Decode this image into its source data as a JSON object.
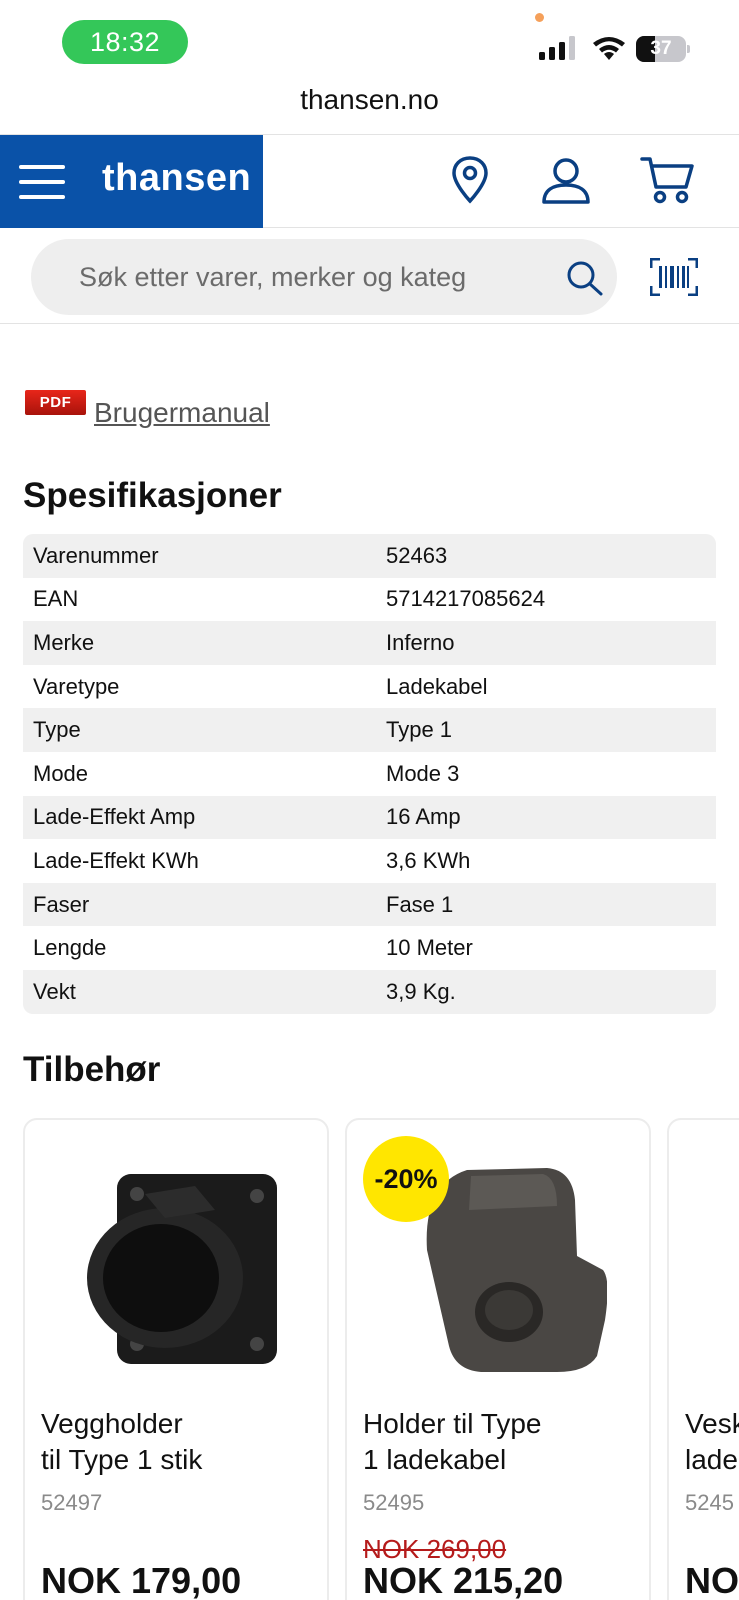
{
  "status_bar": {
    "time": "18:32",
    "battery": "37",
    "battery_level": 0.37
  },
  "browser": {
    "url": "thansen.no"
  },
  "header": {
    "brand": "thansen"
  },
  "search": {
    "placeholder": "Søk etter varer, merker og kateg"
  },
  "manual": {
    "badge": "PDF",
    "label": "Brugermanual"
  },
  "specs": {
    "title": "Spesifikasjoner",
    "rows": [
      {
        "key": "Varenummer",
        "value": "52463"
      },
      {
        "key": "EAN",
        "value": "5714217085624"
      },
      {
        "key": "Merke",
        "value": "Inferno"
      },
      {
        "key": "Varetype",
        "value": "Ladekabel"
      },
      {
        "key": "Type",
        "value": "Type 1"
      },
      {
        "key": "Mode",
        "value": "Mode 3"
      },
      {
        "key": "Lade-Effekt Amp",
        "value": "16 Amp"
      },
      {
        "key": "Lade-Effekt KWh",
        "value": "3,6 KWh"
      },
      {
        "key": "Faser",
        "value": "Fase 1"
      },
      {
        "key": "Lengde",
        "value": "10 Meter"
      },
      {
        "key": "Vekt",
        "value": "3,9 Kg."
      }
    ]
  },
  "accessories": {
    "title": "Tilbehør",
    "products": [
      {
        "name_line1": "Veggholder",
        "name_line2": "til Type 1 stik",
        "sku": "52497",
        "old_price": "",
        "price": "NOK 179,00",
        "badge": ""
      },
      {
        "name_line1": "Holder til Type",
        "name_line2": "1 ladekabel",
        "sku": "52495",
        "old_price": "NOK 269,00",
        "price": "NOK 215,20",
        "badge": "-20%"
      },
      {
        "name_line1": "Vesk",
        "name_line2": "lade",
        "sku": "5245",
        "old_price": "",
        "price": "NOI",
        "badge": ""
      }
    ]
  }
}
